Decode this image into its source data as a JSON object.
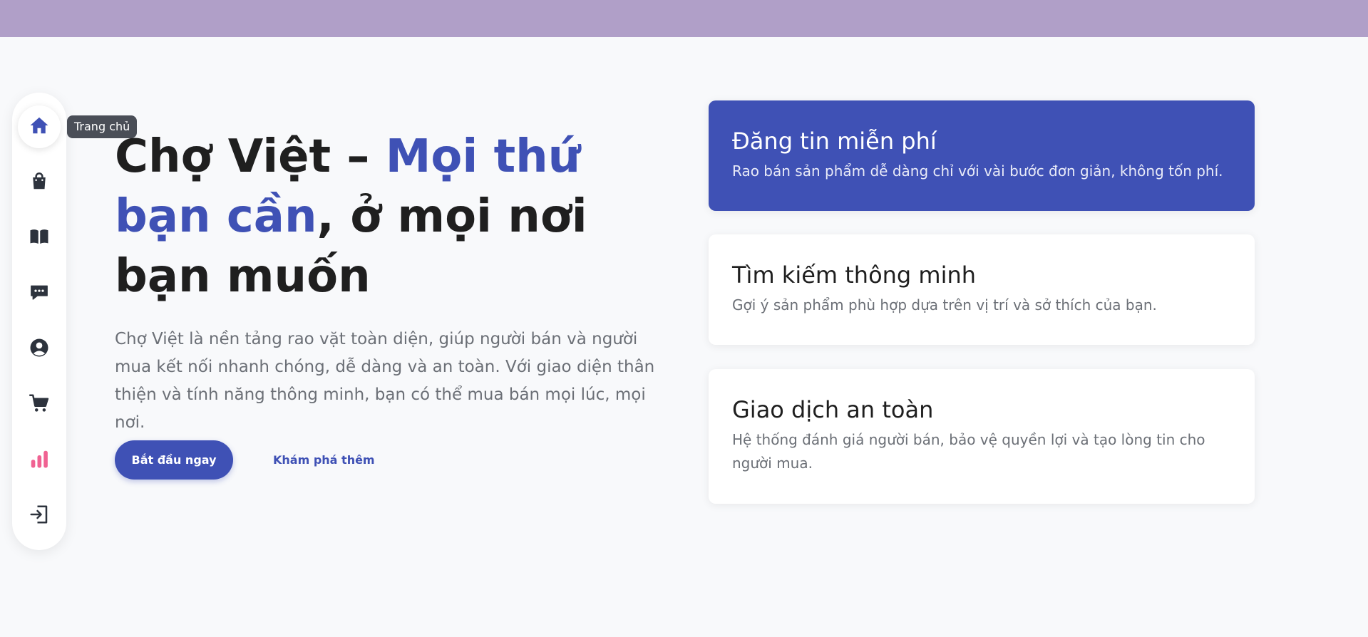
{
  "colors": {
    "accent": "#3f51b5",
    "top_band": "#b09fc8",
    "chart_icon": "#f06292"
  },
  "sidebar": {
    "items": [
      {
        "name": "home",
        "icon": "home-icon",
        "tooltip": "Trang chủ",
        "active": true
      },
      {
        "name": "shopping",
        "icon": "shopping-bag-icon"
      },
      {
        "name": "guide",
        "icon": "book-icon"
      },
      {
        "name": "messages",
        "icon": "chat-icon"
      },
      {
        "name": "account",
        "icon": "user-icon"
      },
      {
        "name": "cart",
        "icon": "cart-icon"
      },
      {
        "name": "stats",
        "icon": "bar-chart-icon"
      },
      {
        "name": "login",
        "icon": "login-icon"
      }
    ]
  },
  "hero": {
    "title_part1": "Chợ Việt – ",
    "title_accent1": "Mọi thứ bạn cần",
    "title_part2": ", ở mọi nơi bạn muốn",
    "description": "Chợ Việt là nền tảng rao vặt toàn diện, giúp người bán và người mua kết nối nhanh chóng, dễ dàng và an toàn. Với giao diện thân thiện và tính năng thông minh, bạn có thể mua bán mọi lúc, mọi nơi.",
    "primary_button": "Bắt đầu ngay",
    "secondary_link": "Khám phá thêm"
  },
  "features": [
    {
      "title": "Đăng tin miễn phí",
      "text": "Rao bán sản phẩm dễ dàng chỉ với vài bước đơn giản, không tốn phí."
    },
    {
      "title": "Tìm kiếm thông minh",
      "text": "Gợi ý sản phẩm phù hợp dựa trên vị trí và sở thích của bạn."
    },
    {
      "title": "Giao dịch an toàn",
      "text": "Hệ thống đánh giá người bán, bảo vệ quyền lợi và tạo lòng tin cho người mua."
    }
  ]
}
